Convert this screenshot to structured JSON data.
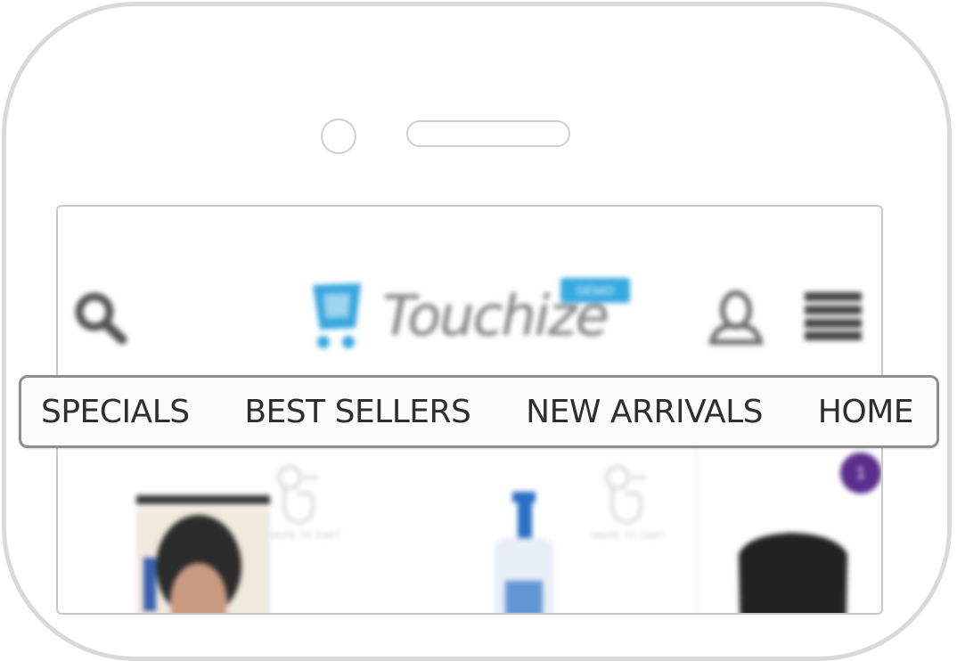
{
  "header": {
    "logo_text": "Touchize",
    "logo_badge": "DEMO",
    "brand_color": "#37a9e0",
    "icons": [
      "search-icon",
      "cart-icon",
      "user-icon",
      "hamburger-menu-icon"
    ]
  },
  "nav": {
    "items": [
      {
        "label": "SPECIALS"
      },
      {
        "label": "BEST SELLERS"
      },
      {
        "label": "NEW ARRIVALS"
      },
      {
        "label": "HOME"
      }
    ]
  },
  "products": {
    "swipe_caption": "SWIPE TO CART",
    "badge_count": "1",
    "badge_color": "#5b2d8c",
    "icons": [
      "tap-hand-icon",
      "product-image"
    ]
  }
}
